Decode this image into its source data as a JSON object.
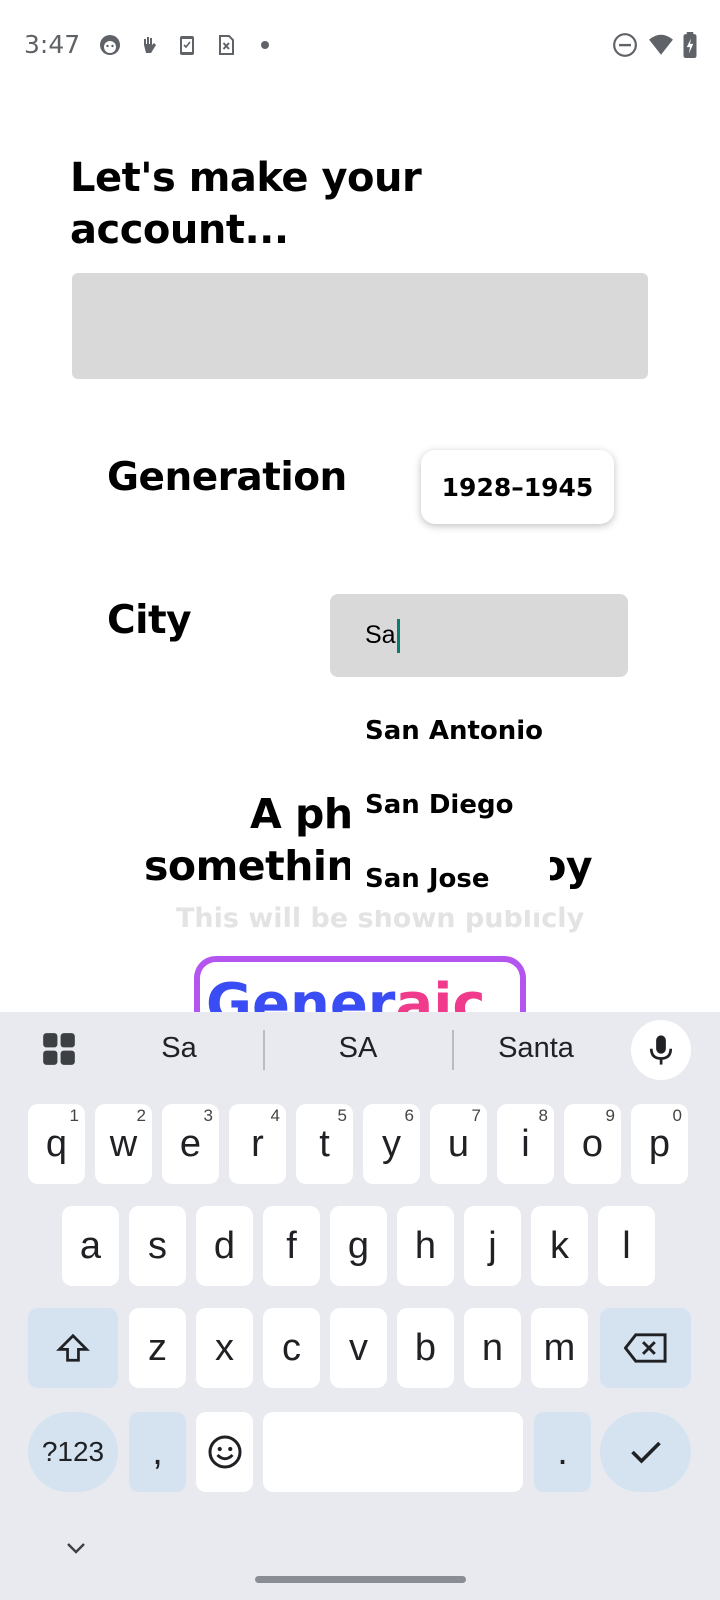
{
  "status": {
    "time": "3:47",
    "icons_left": [
      "face-icon",
      "hand-icon",
      "clipboard-icon",
      "sim-x-icon",
      "dot-icon"
    ],
    "icons_right": [
      "dnd-icon",
      "wifi-icon",
      "battery-icon"
    ]
  },
  "form": {
    "title": "Let's make your account...",
    "generation_label": "Generation",
    "generation_value": "1928–1945",
    "city_label": "City",
    "city_value": "Sa",
    "city_suggestions": [
      "San Antonio",
      "San Diego",
      "San Jose"
    ],
    "photo_heading_left_1": "A ph",
    "photo_heading_left_2": "somethin",
    "photo_heading_right_2": "njoy",
    "photo_note": "This will be shown publicly",
    "brand_part_a": "Gener",
    "brand_part_b": "aic"
  },
  "keyboard": {
    "suggestions": [
      "Sa",
      "SA",
      "Santa"
    ],
    "row1": [
      {
        "k": "q",
        "h": "1"
      },
      {
        "k": "w",
        "h": "2"
      },
      {
        "k": "e",
        "h": "3"
      },
      {
        "k": "r",
        "h": "4"
      },
      {
        "k": "t",
        "h": "5"
      },
      {
        "k": "y",
        "h": "6"
      },
      {
        "k": "u",
        "h": "7"
      },
      {
        "k": "i",
        "h": "8"
      },
      {
        "k": "o",
        "h": "9"
      },
      {
        "k": "p",
        "h": "0"
      }
    ],
    "row2": [
      "a",
      "s",
      "d",
      "f",
      "g",
      "h",
      "j",
      "k",
      "l"
    ],
    "row3": [
      "z",
      "x",
      "c",
      "v",
      "b",
      "n",
      "m"
    ],
    "symbols_label": "?123",
    "comma": ",",
    "period": ".",
    "accent_color": "#d5e3f0"
  }
}
